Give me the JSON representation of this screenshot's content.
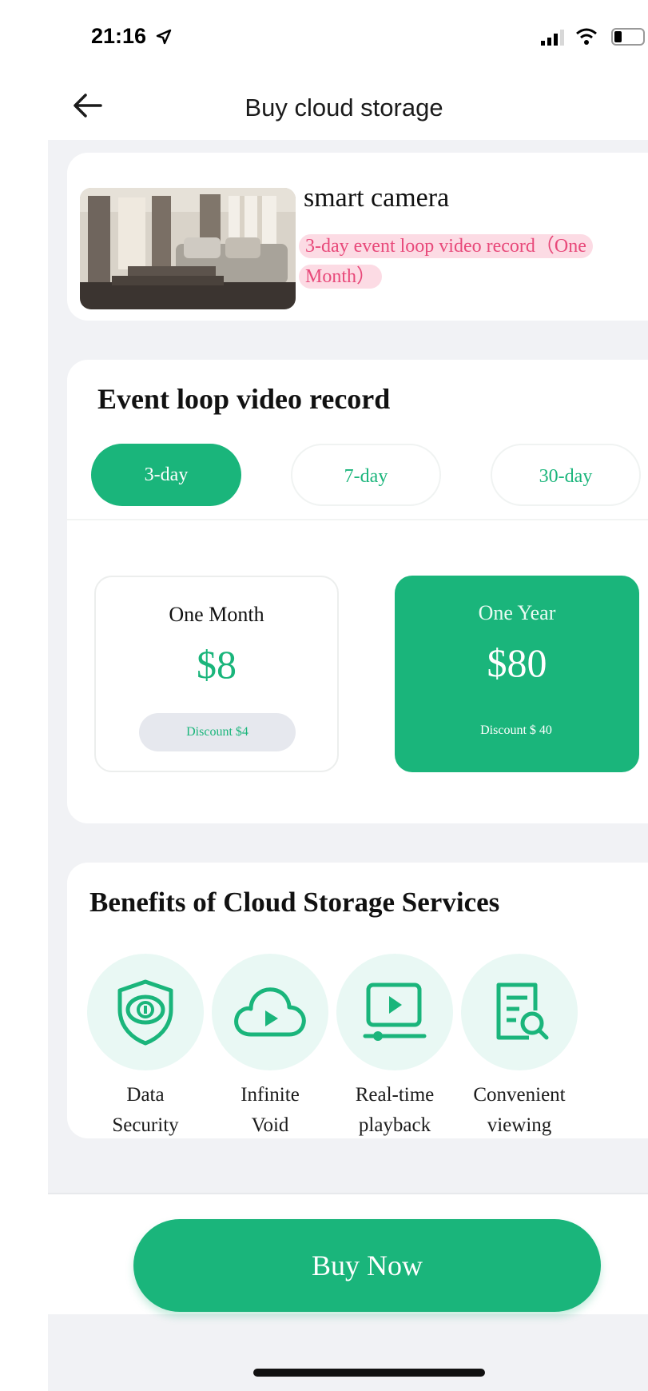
{
  "status_bar": {
    "time": "21:16"
  },
  "nav": {
    "title": "Buy cloud storage",
    "back_icon": "arrow-left-icon"
  },
  "product": {
    "name": "smart camera",
    "tag": "3-day event loop video record（One Month）"
  },
  "plans": {
    "title": "Event loop video record",
    "tabs": [
      {
        "label": "3-day",
        "selected": true
      },
      {
        "label": "7-day",
        "selected": false
      },
      {
        "label": "30-day",
        "selected": false
      }
    ],
    "options": [
      {
        "name": "One Month",
        "price": "$8",
        "discount": "Discount  $4",
        "selected": false
      },
      {
        "name": "One Year",
        "price": "$80",
        "discount": "Discount  $ 40",
        "selected": true
      }
    ]
  },
  "benefits": {
    "title": "Benefits of Cloud Storage Services",
    "items": [
      {
        "line1": "Data",
        "line2": "Security",
        "icon": "shield-icon"
      },
      {
        "line1": "Infinite",
        "line2": "Void",
        "icon": "cloud-play-icon"
      },
      {
        "line1": "Real-time",
        "line2": "playback",
        "icon": "video-player-icon"
      },
      {
        "line1": "Convenient",
        "line2": "viewing",
        "icon": "document-search-icon"
      }
    ]
  },
  "buy_button": {
    "label": "Buy Now"
  },
  "colors": {
    "accent": "#1ab57b",
    "tag_text": "#e8497a",
    "tag_bg": "#fcdbe4",
    "background": "#f1f2f5"
  }
}
